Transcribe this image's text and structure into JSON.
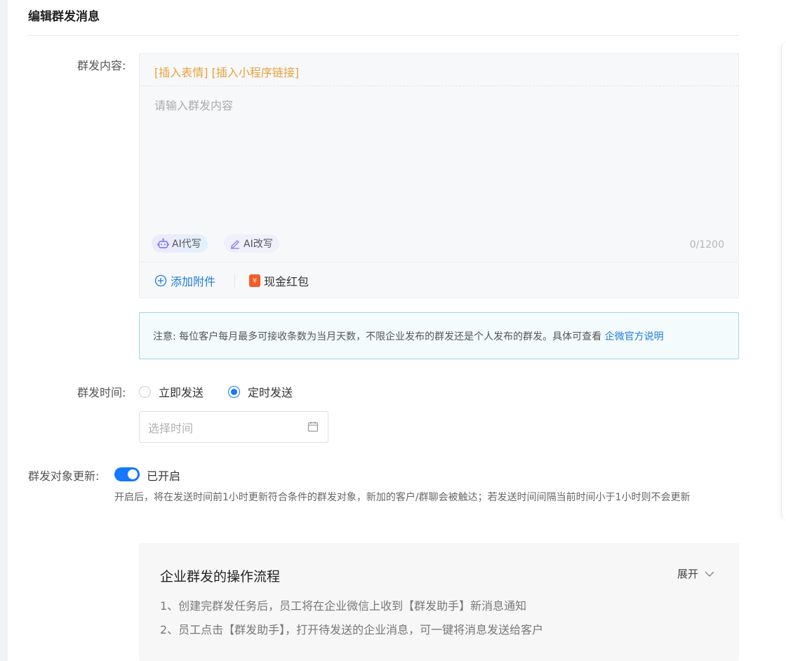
{
  "page": {
    "title": "编辑群发消息"
  },
  "content": {
    "label": "群发内容:",
    "toolbar": {
      "insert_emoji": "[插入表情]",
      "insert_miniprogram": "[插入小程序链接]"
    },
    "placeholder": "请输入群发内容",
    "ai_write": "AI代写",
    "ai_rewrite": "AI改写",
    "counter": "0/1200",
    "add_attachment": "添加附件",
    "cash_redpacket": "现金红包",
    "redpacket_icon_glyph": "¥"
  },
  "notice": {
    "text": "注意:  每位客户每月最多可接收条数为当月天数，不限企业发布的群发还是个人发布的群发。具体可查看 ",
    "link": "企微官方说明"
  },
  "send_time": {
    "label": "群发时间:",
    "options": [
      {
        "label": "立即发送",
        "checked": false
      },
      {
        "label": "定时发送",
        "checked": true
      }
    ],
    "date_placeholder": "选择时间"
  },
  "target_update": {
    "label": "群发对象更新:",
    "enabled": true,
    "status": "已开启",
    "description": "开启后，将在发送时间前1小时更新符合条件的群发对象，新加的客户/群聊会被触达；若发送时间间隔当前时间小于1小时则不会更新"
  },
  "flow": {
    "title": "企业群发的操作流程",
    "expand": "展开",
    "steps": [
      "1、创建完群发任务后，员工将在企业微信上收到【群发助手】新消息通知",
      "2、员工点击【群发助手】，打开待发送的企业消息，可一键将消息发送给客户"
    ]
  },
  "colors": {
    "accent": "#1677ff",
    "link": "#1d7bd8",
    "toolbar_orange": "#e6a23c",
    "redpacket": "#f25c2b"
  },
  "icons": {
    "ai_write": "robot-icon",
    "ai_rewrite": "pen-icon",
    "attachment": "plus-circle-icon",
    "redpacket": "redpacket-icon",
    "calendar": "calendar-icon",
    "expand": "chevron-down-icon"
  }
}
